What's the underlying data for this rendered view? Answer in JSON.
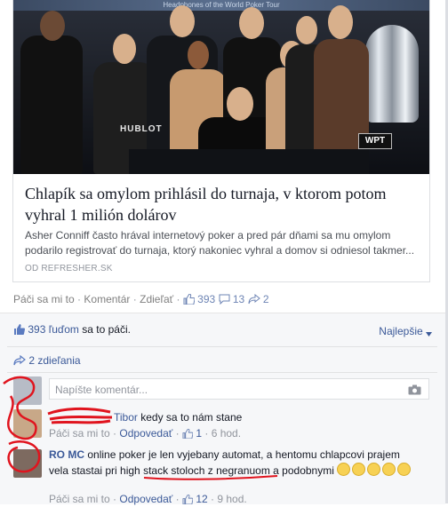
{
  "article": {
    "banner_text": "Headphones of the World Poker Tour",
    "hublot": "HUBLOT",
    "wpt": "WPT",
    "title": "Chlapík sa omylom prihlásil do turnaja, v ktorom potom vyhral 1 milión dolárov",
    "description": "Asher Conniff často hrával internetový poker a pred pár dňami sa mu omylom podarilo registrovať do turnaja, ktorý nakoniec vyhral a domov si odniesol takmer...",
    "source": "OD REFRESHER.SK"
  },
  "post_actions": {
    "like": "Páči sa mi to",
    "comment": "Komentár",
    "share": "Zdieľať",
    "like_count": "393",
    "comment_count": "13",
    "share_count": "2",
    "dot": "·"
  },
  "likes_line": {
    "count_text": "393 ľuďom",
    "suffix": "sa to páči.",
    "sort": "Najlepšie"
  },
  "shares_line": {
    "text": "2 zdieľania"
  },
  "composer": {
    "placeholder": "Napíšte komentár..."
  },
  "comments": [
    {
      "name": "Tibor",
      "text": "kedy sa to nám stane",
      "like": "Páči sa mi to",
      "reply": "Odpovedať",
      "likes": "1",
      "time": "6 hod."
    },
    {
      "name": "RO MC",
      "text_part1": "online poker je len vyjebany automat, a hentomu chlapcovi prajem vela stastai pri high",
      "text_underlined": "stack stoloch z negranuom",
      "text_part2": "a podobnymi",
      "like": "Páči sa mi to",
      "reply": "Odpovedať",
      "likes": "12",
      "time": "9 hod."
    }
  ],
  "colors": {
    "link_blue": "#3b5998",
    "meta_grey": "#90949c",
    "annotation_red": "#e0141e"
  },
  "icons": [
    "thumb-up-icon",
    "comment-bubble-icon",
    "share-arrow-icon",
    "camera-icon",
    "chevron-down-icon",
    "smiley-emoji-icon"
  ]
}
